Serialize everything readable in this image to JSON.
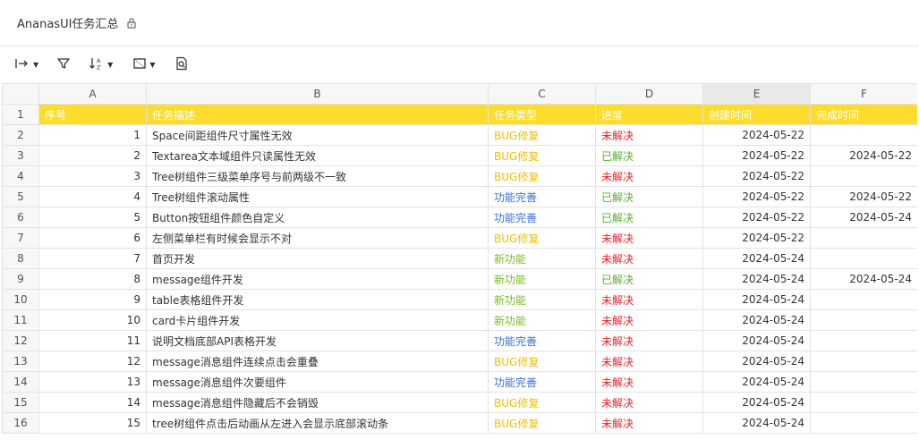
{
  "title": "AnanasUI任务汇总",
  "toolbar": {
    "icons": [
      "freeze-icon",
      "filter-icon",
      "sort-icon",
      "border-icon",
      "search-icon"
    ]
  },
  "colors": {
    "header_bg": "#fddc2b",
    "bug": "#f0c000",
    "func": "#3f6fd0",
    "new": "#7bb928",
    "open": "#e8222d",
    "done": "#58b02e"
  },
  "columns": [
    "A",
    "B",
    "C",
    "D",
    "E",
    "F"
  ],
  "row_numbers": [
    "1",
    "2",
    "3",
    "4",
    "5",
    "6",
    "7",
    "8",
    "9",
    "10",
    "11",
    "12",
    "13",
    "14",
    "15",
    "16"
  ],
  "header": [
    "序号",
    "任务描述",
    "任务类型",
    "进度",
    "创建时间",
    "完成时间"
  ],
  "rows": [
    {
      "no": "1",
      "desc": "Space间距组件尺寸属性无效",
      "type": "BUG修复",
      "type_kind": "bug",
      "status": "未解决",
      "status_kind": "open",
      "created": "2024-05-22",
      "done": ""
    },
    {
      "no": "2",
      "desc": "Textarea文本域组件只读属性无效",
      "type": "BUG修复",
      "type_kind": "bug",
      "status": "已解决",
      "status_kind": "done",
      "created": "2024-05-22",
      "done": "2024-05-22"
    },
    {
      "no": "3",
      "desc": "Tree树组件三级菜单序号与前两级不一致",
      "type": "BUG修复",
      "type_kind": "bug",
      "status": "未解决",
      "status_kind": "open",
      "created": "2024-05-22",
      "done": ""
    },
    {
      "no": "4",
      "desc": "Tree树组件滚动属性",
      "type": "功能完善",
      "type_kind": "func",
      "status": "已解决",
      "status_kind": "done",
      "created": "2024-05-22",
      "done": "2024-05-22"
    },
    {
      "no": "5",
      "desc": "Button按钮组件颜色自定义",
      "type": "功能完善",
      "type_kind": "func",
      "status": "已解决",
      "status_kind": "done",
      "created": "2024-05-22",
      "done": "2024-05-24"
    },
    {
      "no": "6",
      "desc": "左侧菜单栏有时候会显示不对",
      "type": "BUG修复",
      "type_kind": "bug",
      "status": "未解决",
      "status_kind": "open",
      "created": "2024-05-22",
      "done": ""
    },
    {
      "no": "7",
      "desc": "首页开发",
      "type": "新功能",
      "type_kind": "new",
      "status": "未解决",
      "status_kind": "open",
      "created": "2024-05-24",
      "done": ""
    },
    {
      "no": "8",
      "desc": "message组件开发",
      "type": "新功能",
      "type_kind": "new",
      "status": "已解决",
      "status_kind": "done",
      "created": "2024-05-24",
      "done": "2024-05-24"
    },
    {
      "no": "9",
      "desc": "table表格组件开发",
      "type": "新功能",
      "type_kind": "new",
      "status": "未解决",
      "status_kind": "open",
      "created": "2024-05-24",
      "done": ""
    },
    {
      "no": "10",
      "desc": "card卡片组件开发",
      "type": "新功能",
      "type_kind": "new",
      "status": "未解决",
      "status_kind": "open",
      "created": "2024-05-24",
      "done": ""
    },
    {
      "no": "11",
      "desc": "说明文档底部API表格开发",
      "type": "功能完善",
      "type_kind": "func",
      "status": "未解决",
      "status_kind": "open",
      "created": "2024-05-24",
      "done": ""
    },
    {
      "no": "12",
      "desc": "message消息组件连续点击会重叠",
      "type": "BUG修复",
      "type_kind": "bug",
      "status": "未解决",
      "status_kind": "open",
      "created": "2024-05-24",
      "done": ""
    },
    {
      "no": "13",
      "desc": "message消息组件次要组件",
      "type": "功能完善",
      "type_kind": "func",
      "status": "未解决",
      "status_kind": "open",
      "created": "2024-05-24",
      "done": ""
    },
    {
      "no": "14",
      "desc": "message消息组件隐藏后不会销毁",
      "type": "BUG修复",
      "type_kind": "bug",
      "status": "未解决",
      "status_kind": "open",
      "created": "2024-05-24",
      "done": ""
    },
    {
      "no": "15",
      "desc": "tree树组件点击后动画从左进入会显示底部滚动条",
      "type": "BUG修复",
      "type_kind": "bug",
      "status": "未解决",
      "status_kind": "open",
      "created": "2024-05-24",
      "done": ""
    }
  ]
}
